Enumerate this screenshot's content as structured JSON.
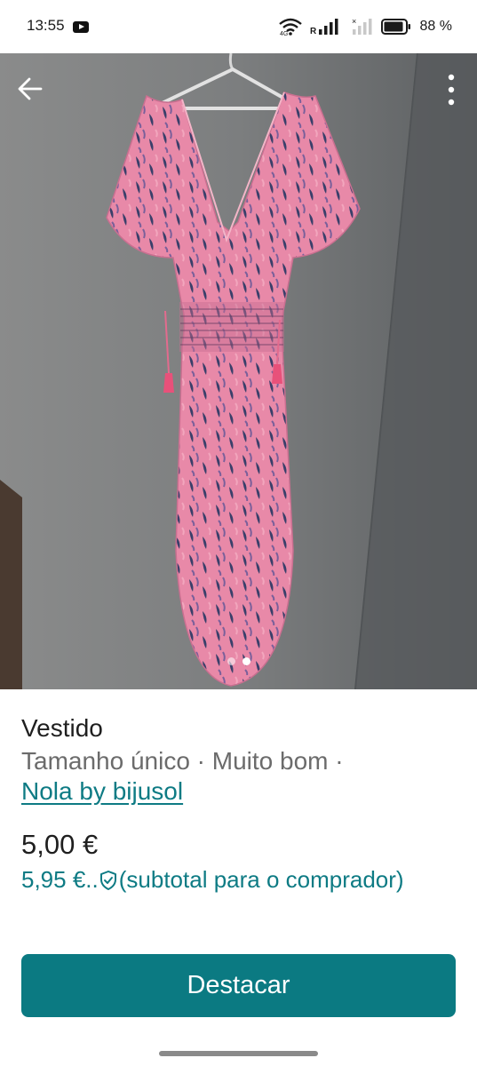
{
  "status_bar": {
    "time": "13:55",
    "battery": "88 %",
    "wifi_label": "4G",
    "signal_label": "R"
  },
  "gallery": {
    "image_subject": "pink and navy tie-dye maxi dress on hanger",
    "page_count": 2,
    "active_page": 2
  },
  "product": {
    "title": "Vestido",
    "meta": "Tamanho único · Muito bom ·",
    "brand": "Nola by bijusol",
    "price": "5,00 €",
    "buyer_price": "5,95 €",
    "buyer_price_ellipsis": "..",
    "buyer_note": "(subtotal para o comprador)"
  },
  "actions": {
    "primary_label": "Destacar"
  },
  "colors": {
    "accent": "#0b7a82",
    "link": "#0e7b84"
  },
  "icons": {
    "back": "arrow-left-icon",
    "more": "more-vertical-icon",
    "shield": "shield-check-icon"
  }
}
